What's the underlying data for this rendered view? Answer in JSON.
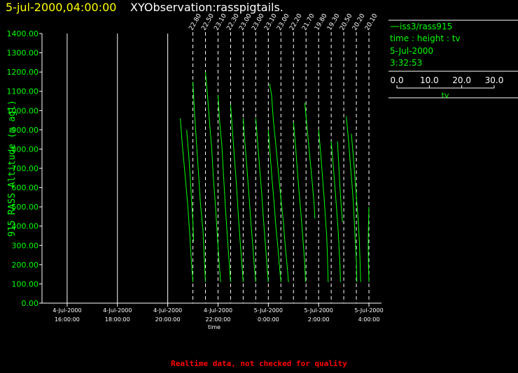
{
  "header": {
    "date_time": "5-jul-2000,04:00:00",
    "title": "XYObservation:rasspigtails."
  },
  "legend": {
    "entry": "iss3/rass915",
    "subtitle": "time : height : tv",
    "date": "5-Jul-2000",
    "time": "3:32:53",
    "scale_ticks": [
      "0.0",
      "10.0",
      "20.0",
      "30.0"
    ],
    "scale_label": "tv"
  },
  "footer": {
    "note": "Realtime data, not checked for quality"
  },
  "colors": {
    "background": "#000000",
    "axis": "#ffffff",
    "data": "#00ff00",
    "title_date": "#ffff00",
    "warning": "#ff0000"
  },
  "chart_data": {
    "type": "line",
    "title": "",
    "xlabel": "time",
    "ylabel": "915 RASS Altitude (m agl)",
    "ylim": [
      0,
      1400
    ],
    "xlim_hours": [
      15.0,
      28.5
    ],
    "x_ticks": [
      {
        "hour": 16,
        "line1": "4-Jul-2000",
        "line2": "16:00:00"
      },
      {
        "hour": 18,
        "line1": "4-Jul-2000",
        "line2": "18:00:00"
      },
      {
        "hour": 20,
        "line1": "4-Jul-2000",
        "line2": "20:00:00"
      },
      {
        "hour": 22,
        "line1": "4-Jul-2000",
        "line2": "22:00:00"
      },
      {
        "hour": 24,
        "line1": "5-Jul-2000",
        "line2": "0:00:00"
      },
      {
        "hour": 26,
        "line1": "5-Jul-2000",
        "line2": "2:00:00"
      },
      {
        "hour": 28,
        "line1": "5-Jul-2000",
        "line2": "4:00:00"
      }
    ],
    "y_ticks": [
      "0.00",
      "100.00",
      "200.00",
      "300.00",
      "400.00",
      "500.00",
      "600.00",
      "700.00",
      "800.00",
      "900.00",
      "1000.00",
      "1100.00",
      "1200.00",
      "1300.00",
      "1400.00"
    ],
    "grid_hours": [
      16,
      18,
      20
    ],
    "scan_lines": [
      {
        "hour": 21.0,
        "label": "22.80"
      },
      {
        "hour": 21.5,
        "label": "22.50"
      },
      {
        "hour": 22.0,
        "label": "23.10"
      },
      {
        "hour": 22.5,
        "label": "22.30"
      },
      {
        "hour": 23.0,
        "label": "23.00"
      },
      {
        "hour": 23.5,
        "label": "23.00"
      },
      {
        "hour": 24.0,
        "label": "23.10"
      },
      {
        "hour": 24.5,
        "label": "23.00"
      },
      {
        "hour": 25.0,
        "label": "22.20"
      },
      {
        "hour": 25.5,
        "label": "21.70"
      },
      {
        "hour": 26.0,
        "label": "19.80"
      },
      {
        "hour": 26.5,
        "label": "19.30"
      },
      {
        "hour": 27.0,
        "label": "20.50"
      },
      {
        "hour": 27.5,
        "label": "20.20"
      },
      {
        "hour": 28.0,
        "label": "20.10"
      }
    ],
    "series": [
      {
        "base_hour": 20.5,
        "points": [
          [
            0.0,
            960
          ],
          [
            0.08,
            820
          ],
          [
            0.2,
            650
          ],
          [
            0.3,
            500
          ],
          [
            0.38,
            350
          ],
          [
            0.45,
            200
          ],
          [
            0.5,
            110
          ]
        ]
      },
      {
        "base_hour": 20.75,
        "points": [
          [
            0.0,
            900
          ],
          [
            0.08,
            780
          ],
          [
            0.15,
            640
          ],
          [
            0.2,
            520
          ],
          [
            0.25,
            420
          ],
          [
            0.28,
            320
          ]
        ]
      },
      {
        "base_hour": 21.0,
        "points": [
          [
            0.0,
            1150
          ],
          [
            0.06,
            1000
          ],
          [
            0.15,
            820
          ],
          [
            0.22,
            680
          ],
          [
            0.3,
            520
          ],
          [
            0.4,
            380
          ],
          [
            0.45,
            250
          ],
          [
            0.5,
            110
          ]
        ]
      },
      {
        "base_hour": 21.5,
        "points": [
          [
            0.0,
            1200
          ],
          [
            0.08,
            1080
          ],
          [
            0.15,
            960
          ],
          [
            0.25,
            800
          ],
          [
            0.32,
            640
          ],
          [
            0.4,
            500
          ],
          [
            0.48,
            330
          ],
          [
            0.55,
            200
          ],
          [
            0.6,
            110
          ]
        ]
      },
      {
        "base_hour": 22.0,
        "points": [
          [
            0.0,
            1080
          ],
          [
            0.06,
            950
          ],
          [
            0.15,
            820
          ],
          [
            0.23,
            640
          ],
          [
            0.3,
            480
          ],
          [
            0.38,
            330
          ],
          [
            0.45,
            200
          ],
          [
            0.5,
            110
          ]
        ]
      },
      {
        "base_hour": 22.5,
        "points": [
          [
            0.0,
            1030
          ],
          [
            0.07,
            900
          ],
          [
            0.15,
            760
          ],
          [
            0.23,
            620
          ],
          [
            0.3,
            470
          ],
          [
            0.38,
            320
          ],
          [
            0.45,
            200
          ],
          [
            0.5,
            110
          ]
        ]
      },
      {
        "base_hour": 23.0,
        "points": [
          [
            0.0,
            960
          ],
          [
            0.07,
            830
          ],
          [
            0.15,
            700
          ],
          [
            0.23,
            560
          ],
          [
            0.3,
            430
          ],
          [
            0.38,
            300
          ],
          [
            0.45,
            180
          ],
          [
            0.5,
            110
          ]
        ]
      },
      {
        "base_hour": 23.5,
        "points": [
          [
            0.0,
            960
          ],
          [
            0.07,
            840
          ],
          [
            0.15,
            710
          ],
          [
            0.23,
            580
          ],
          [
            0.3,
            450
          ],
          [
            0.38,
            310
          ],
          [
            0.45,
            190
          ],
          [
            0.5,
            110
          ]
        ]
      },
      {
        "base_hour": 24.0,
        "points": [
          [
            0.0,
            900
          ],
          [
            0.07,
            780
          ],
          [
            0.15,
            640
          ],
          [
            0.23,
            520
          ],
          [
            0.3,
            400
          ],
          [
            0.38,
            290
          ],
          [
            0.45,
            180
          ],
          [
            0.5,
            110
          ]
        ]
      },
      {
        "base_hour": 24.05,
        "points": [
          [
            0.0,
            1140
          ],
          [
            0.08,
            1080
          ],
          [
            0.15,
            950
          ],
          [
            0.25,
            820
          ],
          [
            0.35,
            680
          ],
          [
            0.45,
            540
          ],
          [
            0.55,
            420
          ],
          [
            0.62,
            300
          ],
          [
            0.7,
            190
          ],
          [
            0.75,
            110
          ]
        ]
      },
      {
        "base_hour": 25.0,
        "points": [
          [
            0.0,
            940
          ],
          [
            0.08,
            820
          ],
          [
            0.15,
            700
          ],
          [
            0.22,
            580
          ],
          [
            0.3,
            460
          ],
          [
            0.37,
            340
          ],
          [
            0.44,
            220
          ],
          [
            0.48,
            110
          ]
        ]
      },
      {
        "base_hour": 25.45,
        "points": [
          [
            0.0,
            1040
          ],
          [
            0.1,
            900
          ],
          [
            0.2,
            760
          ],
          [
            0.3,
            620
          ],
          [
            0.38,
            500
          ],
          [
            0.4,
            440
          ]
        ]
      },
      {
        "base_hour": 26.0,
        "points": [
          [
            0.0,
            900
          ],
          [
            0.08,
            780
          ],
          [
            0.15,
            660
          ],
          [
            0.22,
            540
          ],
          [
            0.28,
            430
          ],
          [
            0.32,
            350
          ],
          [
            0.35,
            240
          ],
          [
            0.38,
            110
          ]
        ]
      },
      {
        "base_hour": 26.5,
        "points": [
          [
            0.0,
            840
          ],
          [
            0.08,
            720
          ],
          [
            0.15,
            600
          ],
          [
            0.22,
            480
          ],
          [
            0.28,
            370
          ],
          [
            0.32,
            270
          ],
          [
            0.35,
            190
          ],
          [
            0.37,
            110
          ]
        ]
      },
      {
        "base_hour": 26.75,
        "points": [
          [
            0.0,
            840
          ],
          [
            0.05,
            720
          ],
          [
            0.1,
            600
          ],
          [
            0.15,
            500
          ],
          [
            0.2,
            420
          ]
        ]
      },
      {
        "base_hour": 27.1,
        "points": [
          [
            0.0,
            970
          ],
          [
            0.08,
            860
          ],
          [
            0.15,
            740
          ],
          [
            0.22,
            630
          ],
          [
            0.28,
            520
          ],
          [
            0.32,
            420
          ],
          [
            0.36,
            320
          ],
          [
            0.4,
            220
          ],
          [
            0.42,
            110
          ]
        ]
      },
      {
        "base_hour": 27.3,
        "points": [
          [
            0.0,
            880
          ],
          [
            0.08,
            760
          ],
          [
            0.15,
            640
          ],
          [
            0.22,
            520
          ],
          [
            0.28,
            420
          ],
          [
            0.32,
            320
          ],
          [
            0.35,
            200
          ],
          [
            0.37,
            110
          ]
        ]
      },
      {
        "base_hour": 28.0,
        "points": [
          [
            0.0,
            500
          ],
          [
            -0.02,
            400
          ],
          [
            -0.03,
            300
          ],
          [
            -0.02,
            200
          ],
          [
            0.0,
            110
          ]
        ]
      }
    ]
  }
}
